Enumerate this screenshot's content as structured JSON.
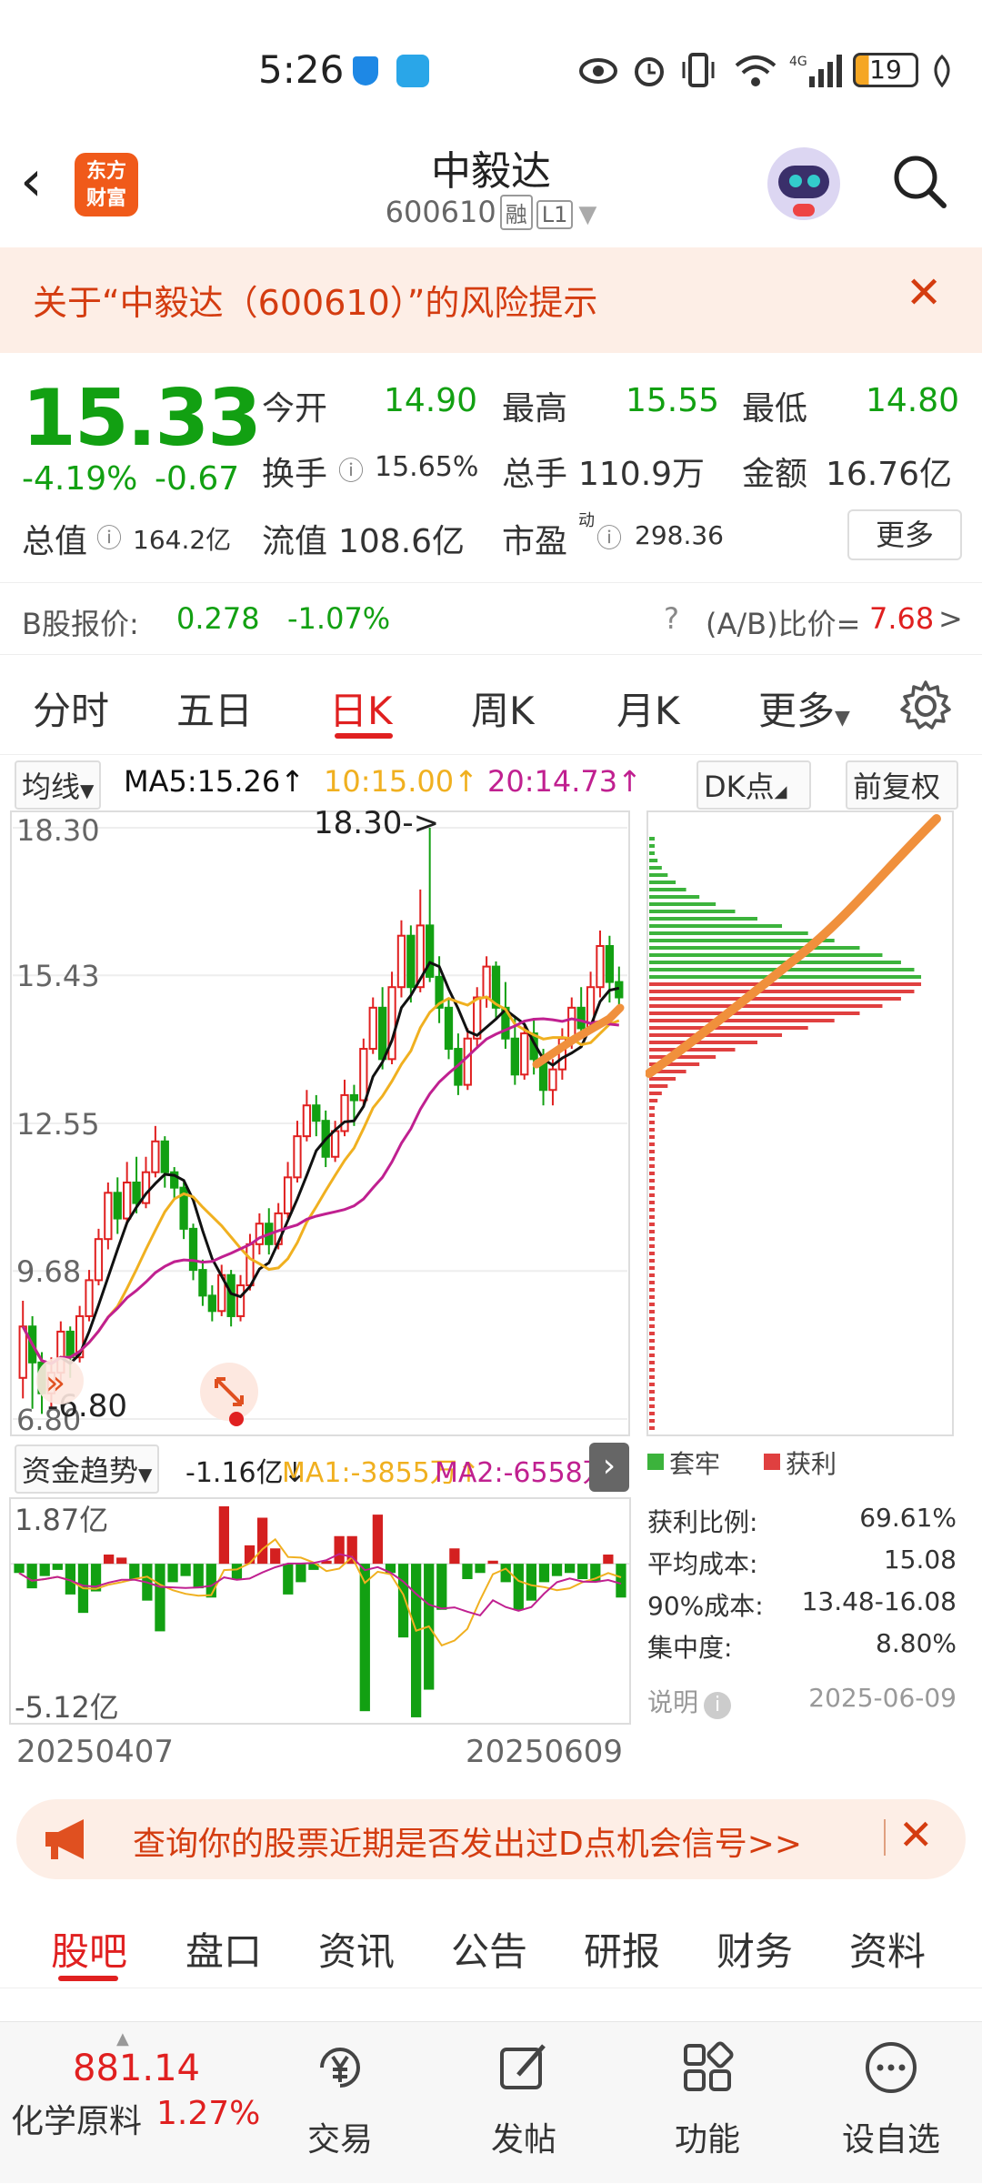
{
  "status_bar": {
    "time": "5:26",
    "battery": "19"
  },
  "header": {
    "logo_line1": "东方",
    "logo_line2": "财富",
    "title": "中毅达",
    "code": "600610",
    "tag_margin": "融",
    "tag_level": "L1"
  },
  "risk_banner": {
    "text": "关于“中毅达（600610）”的风险提示"
  },
  "quote": {
    "price": "15.33",
    "change_pct": "-4.19%",
    "change": "-0.67",
    "open_label": "今开",
    "open": "14.90",
    "high_label": "最高",
    "high": "15.55",
    "low_label": "最低",
    "low": "14.80",
    "turnover_label": "换手",
    "turnover": "15.65%",
    "volume_label": "总手",
    "volume": "110.9万",
    "amount_label": "金额",
    "amount": "16.76亿",
    "mktcap_label": "总值",
    "mktcap": "164.2亿",
    "float_label": "流值",
    "float": "108.6亿",
    "pe_label": "市盈",
    "pe_sup": "动",
    "pe": "298.36",
    "more": "更多"
  },
  "b_share": {
    "label": "B股报价:",
    "price": "0.278",
    "change": "-1.07%",
    "ratio_label": "(A/B)比价=",
    "ratio": "7.68",
    "arrow": ">"
  },
  "chart_tabs": [
    "分时",
    "五日",
    "日K",
    "周K",
    "月K",
    "更多"
  ],
  "ma_bar": {
    "selector": "均线",
    "ma5": "MA5:15.26↑",
    "ma10": "10:15.00↑",
    "ma20": "20:14.73↑",
    "dk": "DK点",
    "adjust": "前复权"
  },
  "colors": {
    "up": "#e02020",
    "down": "#12a012",
    "ma5": "#111111",
    "ma10": "#f0b020",
    "ma20": "#c02090",
    "trend": "#f0903c"
  },
  "chart_data": [
    {
      "type": "candlestick",
      "y_ticks": [
        "18.30",
        "15.43",
        "12.55",
        "9.68",
        "6.80"
      ],
      "ylim": [
        6.8,
        18.3
      ],
      "high_annotation": "18.30->",
      "low_annotation": "-6.80",
      "candles": [
        [
          7.6,
          8.6,
          9.1,
          7.2
        ],
        [
          8.6,
          7.9,
          8.8,
          7.0
        ],
        [
          7.9,
          7.3,
          8.1,
          6.9
        ],
        [
          7.3,
          7.7,
          8.0,
          7.0
        ],
        [
          7.7,
          8.5,
          8.7,
          7.5
        ],
        [
          8.5,
          8.0,
          8.6,
          7.6
        ],
        [
          8.0,
          8.8,
          9.0,
          7.9
        ],
        [
          8.8,
          9.5,
          9.7,
          8.7
        ],
        [
          9.5,
          10.3,
          10.5,
          9.4
        ],
        [
          10.3,
          11.2,
          11.4,
          10.1
        ],
        [
          11.2,
          10.7,
          11.5,
          10.4
        ],
        [
          10.7,
          11.4,
          11.8,
          10.6
        ],
        [
          11.4,
          11.0,
          11.9,
          10.8
        ],
        [
          11.0,
          11.6,
          11.9,
          10.9
        ],
        [
          11.6,
          12.2,
          12.5,
          11.5
        ],
        [
          12.2,
          11.6,
          12.3,
          11.3
        ],
        [
          11.6,
          11.3,
          11.7,
          11.1
        ],
        [
          11.3,
          10.5,
          11.4,
          10.3
        ],
        [
          10.5,
          9.7,
          10.6,
          9.5
        ],
        [
          9.7,
          9.2,
          9.9,
          9.0
        ],
        [
          9.2,
          8.9,
          9.4,
          8.7
        ],
        [
          8.9,
          9.6,
          9.8,
          8.8
        ],
        [
          9.6,
          8.8,
          9.7,
          8.6
        ],
        [
          8.8,
          9.4,
          9.6,
          8.7
        ],
        [
          9.4,
          10.2,
          10.4,
          9.3
        ],
        [
          10.2,
          10.6,
          10.8,
          10.0
        ],
        [
          10.6,
          10.2,
          10.9,
          10.0
        ],
        [
          10.2,
          10.8,
          11.0,
          10.1
        ],
        [
          10.8,
          11.5,
          11.8,
          10.7
        ],
        [
          11.5,
          12.3,
          12.6,
          11.4
        ],
        [
          12.3,
          12.9,
          13.2,
          12.2
        ],
        [
          12.9,
          12.6,
          13.1,
          12.3
        ],
        [
          12.6,
          11.9,
          12.8,
          11.7
        ],
        [
          11.9,
          12.4,
          12.6,
          11.8
        ],
        [
          12.4,
          13.1,
          13.4,
          12.3
        ],
        [
          13.1,
          13.0,
          13.3,
          12.5
        ],
        [
          13.0,
          14.0,
          14.2,
          12.9
        ],
        [
          14.0,
          14.8,
          15.0,
          13.9
        ],
        [
          14.8,
          13.8,
          15.2,
          13.6
        ],
        [
          13.8,
          15.2,
          15.5,
          13.7
        ],
        [
          15.2,
          16.2,
          16.5,
          15.0
        ],
        [
          16.2,
          15.2,
          16.4,
          14.9
        ],
        [
          15.2,
          16.4,
          17.1,
          15.1
        ],
        [
          16.4,
          15.4,
          18.3,
          15.3
        ],
        [
          15.4,
          14.8,
          15.8,
          14.5
        ],
        [
          14.8,
          14.0,
          15.0,
          13.8
        ],
        [
          14.0,
          13.3,
          14.3,
          13.1
        ],
        [
          13.3,
          14.2,
          14.4,
          13.2
        ],
        [
          14.2,
          15.0,
          15.2,
          14.0
        ],
        [
          15.0,
          15.6,
          15.8,
          14.8
        ],
        [
          15.6,
          14.8,
          15.7,
          14.6
        ],
        [
          14.8,
          14.2,
          15.3,
          14.0
        ],
        [
          14.2,
          13.5,
          14.6,
          13.3
        ],
        [
          13.5,
          14.3,
          14.5,
          13.4
        ],
        [
          14.3,
          13.8,
          14.6,
          13.5
        ],
        [
          13.8,
          13.2,
          14.0,
          12.9
        ],
        [
          13.2,
          13.6,
          13.8,
          12.9
        ],
        [
          13.6,
          14.2,
          14.4,
          13.4
        ],
        [
          14.2,
          14.8,
          15.0,
          14.0
        ],
        [
          14.8,
          14.4,
          15.2,
          14.2
        ],
        [
          14.4,
          15.2,
          15.5,
          14.3
        ],
        [
          15.2,
          16.0,
          16.3,
          15.0
        ],
        [
          16.0,
          15.3,
          16.2,
          14.9
        ],
        [
          15.3,
          15.0,
          15.6,
          14.8
        ]
      ]
    },
    {
      "type": "bar",
      "title": "资金趋势",
      "y_ticks": [
        "1.87亿",
        "-5.12亿"
      ],
      "ylim": [
        -5.12,
        1.87
      ],
      "values": [
        -0.3,
        -0.8,
        -0.4,
        -0.2,
        -1.0,
        -1.6,
        -0.9,
        0.3,
        0.2,
        -0.5,
        -1.2,
        -2.2,
        -0.6,
        -0.4,
        -0.8,
        -1.1,
        1.87,
        -0.5,
        0.6,
        1.5,
        0.5,
        -1.0,
        -0.6,
        -0.2,
        0.1,
        0.9,
        0.9,
        -4.8,
        1.6,
        -0.3,
        -2.4,
        -5.0,
        -4.1,
        -1.5,
        0.5,
        -0.5,
        -0.3,
        0.1,
        -0.6,
        -1.5,
        -1.2,
        -0.6,
        -0.4,
        -0.3,
        -0.5,
        -0.6,
        0.3,
        -1.1
      ]
    },
    {
      "type": "bar",
      "title": "chips",
      "series": [
        {
          "name": "套牢"
        },
        {
          "name": "获利"
        }
      ]
    }
  ],
  "fund_bar": {
    "selector": "资金趋势",
    "value": "-1.16亿↓",
    "ma1": "MA1:-3855万↑",
    "ma2": "MA2:-6558万↓"
  },
  "chip_info": {
    "legend_trapped": "套牢",
    "legend_profit": "获利",
    "rows": [
      {
        "label": "获利比例:",
        "value": "69.61%"
      },
      {
        "label": "平均成本:",
        "value": "15.08"
      },
      {
        "label": "90%成本:",
        "value": "13.48-16.08"
      },
      {
        "label": "集中度:",
        "value": "8.80%"
      }
    ],
    "note": "说明",
    "date": "2025-06-09"
  },
  "x_dates": {
    "start": "20250407",
    "end": "20250609"
  },
  "promo": {
    "text": "查询你的股票近期是否发出过D点机会信号>>"
  },
  "bottom_tabs": [
    "股吧",
    "盘口",
    "资讯",
    "公告",
    "研报",
    "财务",
    "资料"
  ],
  "footer": {
    "index_value": "881.14",
    "index_name": "化学原料",
    "index_change": "1.27%",
    "buttons": [
      "交易",
      "发帖",
      "功能",
      "设自选"
    ]
  }
}
